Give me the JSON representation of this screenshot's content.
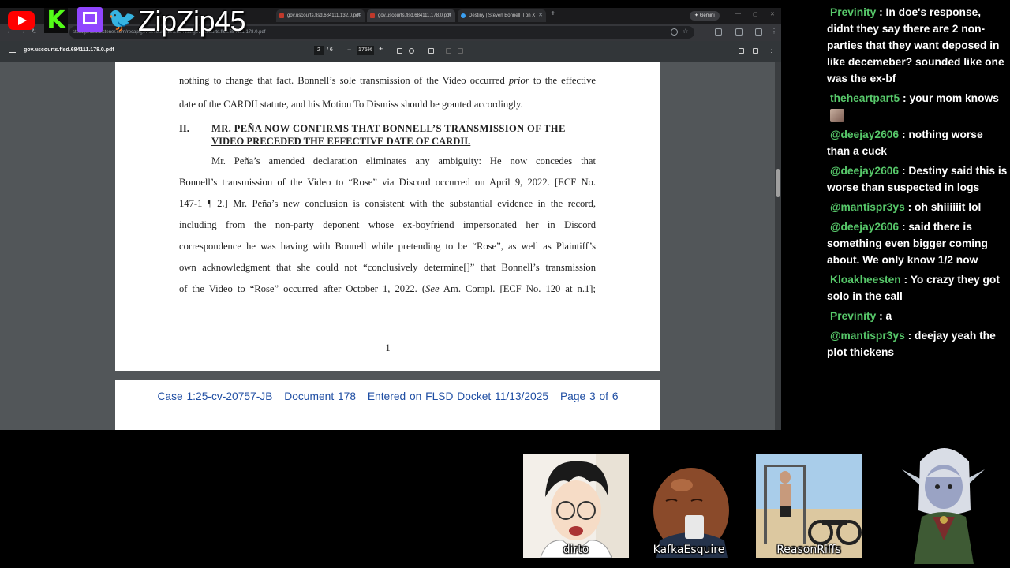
{
  "overlay": {
    "channel_name": "ZipZip45",
    "platform_icons": [
      "youtube-icon",
      "kick-icon",
      "twitch-icon",
      "twitter-icon"
    ]
  },
  "browser": {
    "tabs": [
      {
        "label": "gov.uscourts.flsd.684111.132.0.pdf"
      },
      {
        "label": "gov.uscourts.flsd.684111.178.0.pdf"
      },
      {
        "label": "Destiny | Steven Bonnell II on X"
      }
    ],
    "gemini_label": "Gemini",
    "url": "storage.courtlistener.com/recap/gov.uscourts.flsd.684111/gov.uscourts.flsd.684111.178.0.pdf"
  },
  "pdf_toolbar": {
    "filename": "gov.uscourts.flsd.684111.178.0.pdf",
    "current_page": "2",
    "total_pages": "/ 6",
    "zoom": "175%"
  },
  "document": {
    "lines_top": [
      {
        "pre": "nothing to change that fact. Bonnell’s sole transmission of the Video occurred ",
        "em": "prior",
        "post": " to the effective"
      },
      {
        "text": "date of the CARDII statute, and his Motion To Dismiss should be granted accordingly."
      }
    ],
    "heading_number": "II.",
    "heading_lines": [
      "MR. PEÑA NOW CONFIRMS THAT BONNELL’S TRANSMISSION OF THE",
      "VIDEO PRECEDED THE EFFECTIVE DATE OF CARDII."
    ],
    "body_lines": [
      "Mr. Peña’s amended declaration eliminates any ambiguity: He now concedes that",
      "Bonnell’s transmission of the Video to “Rose” via Discord occurred on April 9, 2022. [ECF No.",
      "147-1 ¶ 2.] Mr. Peña’s new conclusion is consistent with the substantial evidence in the record,",
      "including from the non-party deponent whose ex-boyfriend impersonated her in Discord",
      "correspondence he was having with Bonnell while pretending to be “Rose”, as well as Plaintiff’s",
      "own acknowledgment that she could not “conclusively determine[]” that Bonnell’s transmission"
    ],
    "last_line": {
      "pre": "of the Video to “Rose” occurred after October 1, 2022. (",
      "em": "See",
      "post": " Am. Compl. [ECF No. 120 at n.1];"
    },
    "page_number": "1",
    "case_header": {
      "case": "Case 1:25-cv-20757-JB",
      "doc": "Document 178",
      "entered": "Entered on FLSD Docket 11/13/2025",
      "page": "Page 3 of 6"
    }
  },
  "chat": [
    {
      "user": "Previnity",
      "text": "In doe's response, didnt they say there are 2 non-parties that they want deposed in like decemeber? sounded like one was the ex-bf"
    },
    {
      "user": "theheartpart5",
      "text": "your mom knows",
      "emote": true
    },
    {
      "user": "@deejay2606",
      "text": "nothing worse than a cuck"
    },
    {
      "user": "@deejay2606",
      "text": "Destiny said this is worse than suspected in logs"
    },
    {
      "user": "@mantispr3ys",
      "text": "oh shiiiiiit lol"
    },
    {
      "user": "@deejay2606",
      "text": "said there is something even bigger coming about. We only know 1/2 now"
    },
    {
      "user": "Kloakheesten",
      "text": "Yo crazy they got solo in the call"
    },
    {
      "user": "Previnity",
      "text": "a"
    },
    {
      "user": "@mantispr3ys",
      "text": "deejay yeah the plot thickens"
    }
  ],
  "participants": [
    {
      "name": "dirto"
    },
    {
      "name": "KafkaEsquire"
    },
    {
      "name": "ReasonRiffs"
    }
  ]
}
